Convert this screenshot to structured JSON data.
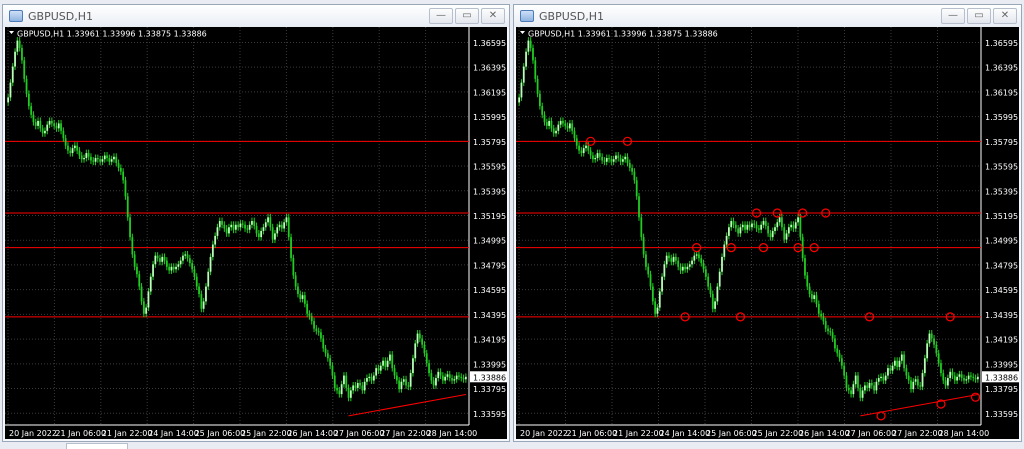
{
  "windows": [
    {
      "title": "GBPUSD,H1",
      "symbol_info": "GBPUSD,H1  1.33961 1.33996 1.33875 1.33886",
      "current_price": "1.33886",
      "price_labels": [
        "1.36595",
        "1.36395",
        "1.36195",
        "1.35995",
        "1.35795",
        "1.35595",
        "1.35395",
        "1.35195",
        "1.34995",
        "1.34795",
        "1.34595",
        "1.34395",
        "1.34195",
        "1.33995",
        "1.33795",
        "1.33595"
      ],
      "time_labels": [
        "20 Jan 2022",
        "21 Jan 06:00",
        "21 Jan 22:00",
        "24 Jan 14:00",
        "25 Jan 06:00",
        "25 Jan 22:00",
        "26 Jan 14:00",
        "27 Jan 06:00",
        "27 Jan 22:00",
        "28 Jan 14:00"
      ],
      "markers": false
    },
    {
      "title": "GBPUSD,H1",
      "symbol_info": "GBPUSD,H1  1.33961 1.33996 1.33875 1.33886",
      "current_price": "1.33886",
      "price_labels": [
        "1.36595",
        "1.36395",
        "1.36195",
        "1.35995",
        "1.35795",
        "1.35595",
        "1.35395",
        "1.35195",
        "1.34995",
        "1.34795",
        "1.34595",
        "1.34395",
        "1.34195",
        "1.33995",
        "1.33795",
        "1.33595"
      ],
      "time_labels": [
        "20 Jan 2022",
        "21 Jan 06:00",
        "21 Jan 22:00",
        "24 Jan 14:00",
        "25 Jan 06:00",
        "25 Jan 22:00",
        "26 Jan 14:00",
        "27 Jan 06:00",
        "27 Jan 22:00",
        "28 Jan 14:00"
      ],
      "markers": true
    }
  ],
  "window_buttons": {
    "minimize": "—",
    "restore": "▭",
    "close": "✕"
  },
  "chart_data": {
    "type": "line",
    "series": [
      {
        "x": [
          0,
          1,
          2,
          3,
          4,
          5,
          6,
          7,
          8,
          9,
          10,
          11,
          12,
          13,
          14,
          15,
          16,
          17,
          18,
          19,
          20,
          21,
          22,
          23,
          24,
          25,
          26,
          27,
          28,
          29,
          30,
          31,
          32,
          33,
          34,
          35,
          36,
          37,
          38,
          39,
          40,
          41,
          42,
          43,
          44,
          45,
          46,
          47,
          48,
          49,
          50,
          51,
          52,
          53,
          54,
          55,
          56,
          57,
          58,
          59,
          60,
          61,
          62,
          63,
          64,
          65,
          66,
          67,
          68,
          69,
          70,
          71,
          72,
          73,
          74,
          75,
          76,
          77,
          78,
          79,
          80,
          81,
          82,
          83,
          84,
          85,
          86,
          87,
          88,
          89,
          90,
          91,
          92,
          93,
          94,
          95,
          96,
          97,
          98,
          99,
          100,
          101,
          102,
          103,
          104,
          105,
          106,
          107,
          108,
          109,
          110,
          111,
          112,
          113,
          114,
          115,
          116,
          117,
          118,
          119,
          120,
          121,
          122,
          123,
          124,
          125,
          126,
          127,
          128,
          129,
          130,
          131,
          132,
          133,
          134,
          135,
          136,
          137,
          138,
          139,
          140,
          141,
          142,
          143,
          144,
          145,
          146,
          147,
          148,
          149,
          150,
          151,
          152,
          153,
          154,
          155,
          156,
          157,
          158,
          159,
          160,
          161,
          162,
          163,
          164,
          165,
          166,
          167,
          168,
          169,
          170,
          171,
          172,
          173,
          174,
          175,
          176,
          177,
          178,
          179,
          180,
          181,
          182,
          183,
          184,
          185,
          186,
          187,
          188,
          189,
          190,
          191,
          192,
          193,
          194,
          195,
          196,
          197,
          198,
          199
        ],
        "values": [
          1.3615,
          1.3627,
          1.364,
          1.3652,
          1.3661,
          1.3655,
          1.3645,
          1.363,
          1.3618,
          1.3608,
          1.3601,
          1.3595,
          1.3592,
          1.3596,
          1.359,
          1.3586,
          1.3588,
          1.3593,
          1.3596,
          1.3594,
          1.3592,
          1.359,
          1.3594,
          1.3588,
          1.3582,
          1.3576,
          1.3572,
          1.357,
          1.3574,
          1.3576,
          1.3572,
          1.3568,
          1.3565,
          1.3566,
          1.357,
          1.3567,
          1.3564,
          1.3563,
          1.3566,
          1.3565,
          1.3563,
          1.3565,
          1.3568,
          1.3566,
          1.3563,
          1.3565,
          1.3567,
          1.3562,
          1.3558,
          1.3555,
          1.3548,
          1.3535,
          1.3518,
          1.3502,
          1.3488,
          1.3478,
          1.3472,
          1.3462,
          1.345,
          1.344,
          1.3445,
          1.3458,
          1.347,
          1.348,
          1.3487,
          1.3485,
          1.3482,
          1.3486,
          1.3483,
          1.3478,
          1.3475,
          1.3478,
          1.3476,
          1.3478,
          1.348,
          1.3483,
          1.3487,
          1.3488,
          1.3485,
          1.3481,
          1.3476,
          1.347,
          1.3462,
          1.3456,
          1.3444,
          1.345,
          1.3462,
          1.3474,
          1.3486,
          1.3496,
          1.3503,
          1.351,
          1.3515,
          1.3512,
          1.3509,
          1.3505,
          1.351,
          1.3512,
          1.3508,
          1.3512,
          1.351,
          1.3513,
          1.3512,
          1.3509,
          1.3508,
          1.3512,
          1.3515,
          1.3511,
          1.3505,
          1.3502,
          1.3507,
          1.351,
          1.3514,
          1.3518,
          1.351,
          1.35,
          1.3505,
          1.351,
          1.3512,
          1.3509,
          1.3514,
          1.3518,
          1.3502,
          1.3485,
          1.3471,
          1.3462,
          1.3456,
          1.3452,
          1.3455,
          1.3448,
          1.344,
          1.3438,
          1.3434,
          1.3428,
          1.3426,
          1.3425,
          1.342,
          1.3412,
          1.3408,
          1.3404,
          1.3398,
          1.339,
          1.338,
          1.3378,
          1.3375,
          1.3383,
          1.339,
          1.338,
          1.3372,
          1.3378,
          1.3382,
          1.338,
          1.3384,
          1.3382,
          1.3378,
          1.3385,
          1.3388,
          1.3389,
          1.3386,
          1.339,
          1.3396,
          1.3394,
          1.3398,
          1.3402,
          1.3397,
          1.3402,
          1.3407,
          1.3396,
          1.339,
          1.3386,
          1.3379,
          1.3385,
          1.3387,
          1.3382,
          1.3381,
          1.3392,
          1.3404,
          1.3416,
          1.3424,
          1.342,
          1.3415,
          1.3408,
          1.34,
          1.3392,
          1.3386,
          1.3382,
          1.3388,
          1.3393,
          1.339,
          1.3386,
          1.3389,
          1.3391,
          1.3388,
          1.3386,
          1.3387,
          1.339,
          1.3389,
          1.3388,
          1.3387,
          1.3389
        ]
      }
    ],
    "ylim": [
      1.335,
      1.3672
    ],
    "horizontal_lines": [
      1.35795,
      1.35215,
      1.34935,
      1.34375
    ],
    "trendline": {
      "x": [
        148,
        199
      ],
      "y": [
        1.33574,
        1.33747
      ]
    },
    "marker_points": [
      {
        "x": 31,
        "y": 1.35795
      },
      {
        "x": 47,
        "y": 1.35795
      },
      {
        "x": 72,
        "y": 1.34375
      },
      {
        "x": 96,
        "y": 1.34375
      },
      {
        "x": 152,
        "y": 1.34375
      },
      {
        "x": 187,
        "y": 1.34375
      },
      {
        "x": 77,
        "y": 1.34935
      },
      {
        "x": 92,
        "y": 1.34935
      },
      {
        "x": 106,
        "y": 1.34935
      },
      {
        "x": 121,
        "y": 1.34935
      },
      {
        "x": 128,
        "y": 1.34935
      },
      {
        "x": 103,
        "y": 1.35215
      },
      {
        "x": 112,
        "y": 1.35215
      },
      {
        "x": 123,
        "y": 1.35215
      },
      {
        "x": 133,
        "y": 1.35215
      },
      {
        "x": 157,
        "y": 1.33574
      },
      {
        "x": 183,
        "y": 1.3367
      },
      {
        "x": 198,
        "y": 1.33725
      }
    ],
    "colors": {
      "candle": "#22cc22",
      "candle_light": "#b7ffb7",
      "level": "#ff0000",
      "grid": "#3a3a3a",
      "axis_text": "#ffffff"
    }
  }
}
